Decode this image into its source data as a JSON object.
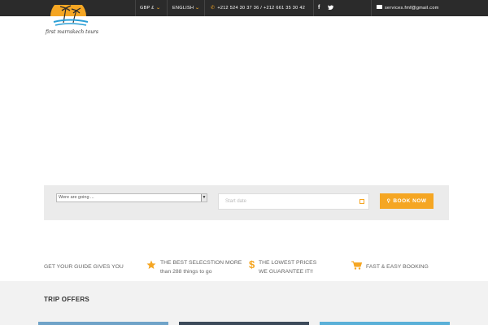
{
  "topbar": {
    "currency": "GBP £",
    "language": "ENGLISH",
    "phones": "+212 524 30 37 36  /  +212 661 35 30 42",
    "social": [
      {
        "icon": "facebook-icon",
        "label": "f"
      },
      {
        "icon": "twitter-icon",
        "label": "t"
      }
    ],
    "email": "services.fmf@gmail.com"
  },
  "logo": {
    "text": "first marrakech tours"
  },
  "search": {
    "destination_placeholder": "Were are going ...",
    "date_placeholder": "Start date",
    "book_label": "BOOK NOW"
  },
  "features": {
    "intro": "GET YOUR GUIDE GIVES YOU",
    "items": [
      {
        "icon": "star-icon",
        "line1": "THE BEST SELECSTION MORE",
        "line2": "than 288 things to go"
      },
      {
        "icon": "dollar-icon",
        "line1": "THE LOWEST PRICES",
        "line2": "WE GUARANTEE IT!!"
      },
      {
        "icon": "cart-icon",
        "line1": "FAST & EASY BOOKING",
        "line2": ""
      }
    ]
  },
  "offers": {
    "title": "TRIP OFFERS"
  },
  "colors": {
    "accent": "#f5a623",
    "topbar": "#2b2b2b"
  }
}
